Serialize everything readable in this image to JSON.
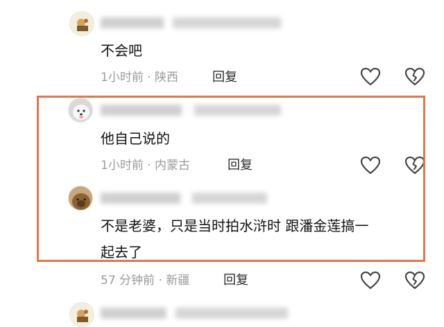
{
  "comments": [
    {
      "text": "不会吧",
      "time": "1小时前",
      "location": "陕西",
      "reply_label": "回复",
      "avatar": "cartoon-avatar"
    },
    {
      "text": "他自己说的",
      "time": "1小时前",
      "location": "内蒙古",
      "reply_label": "回复",
      "avatar": "white-puppy-avatar"
    },
    {
      "text_line1": "不是老婆，只是当时拍水浒时 跟潘金莲搞一",
      "text_line2": "起去了",
      "time": "57 分钟前",
      "location": "新疆",
      "reply_label": "回复",
      "avatar": "brown-dog-avatar"
    }
  ],
  "separator": " · ",
  "colors": {
    "highlight_border": "#e8724a",
    "meta_text": "#9a9a9a",
    "comment_text": "#111111"
  },
  "icons": [
    "heart-icon",
    "broken-heart-icon"
  ]
}
